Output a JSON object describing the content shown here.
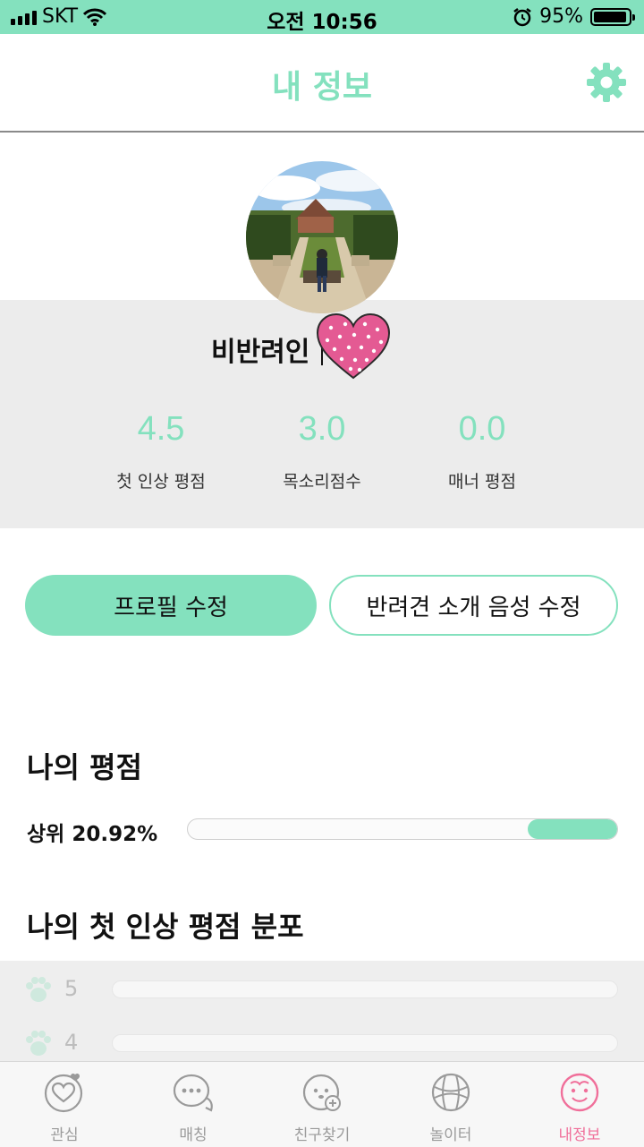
{
  "status_bar": {
    "carrier": "SKT",
    "time": "오전 10:56",
    "battery": "95%",
    "battery_level": 0.95
  },
  "header": {
    "title": "내 정보",
    "settings_icon": "gear-icon"
  },
  "profile": {
    "name": "비반려인"
  },
  "stats": [
    {
      "value": "4.5",
      "label": "첫 인상 평점"
    },
    {
      "value": "3.0",
      "label": "목소리점수"
    },
    {
      "value": "0.0",
      "label": "매너 평점"
    }
  ],
  "buttons": {
    "edit_profile": "프로필 수정",
    "edit_voice": "반려견 소개 음성 수정"
  },
  "rating": {
    "title": "나의 평점",
    "rank_label": "상위 20.92%",
    "rank_fill": 0.2092
  },
  "distribution": {
    "title": "나의 첫 인상 평점 분포",
    "rows": [
      {
        "score": "5"
      },
      {
        "score": "4"
      }
    ]
  },
  "tabs": [
    {
      "label": "관심",
      "icon": "heart-bubble-icon"
    },
    {
      "label": "매칭",
      "icon": "chat-bubbles-icon"
    },
    {
      "label": "친구찾기",
      "icon": "dog-plus-icon"
    },
    {
      "label": "놀이터",
      "icon": "ball-icon"
    },
    {
      "label": "내정보",
      "icon": "smiley-icon",
      "active": true
    }
  ],
  "colors": {
    "accent": "#84e1be",
    "active_tab": "#f06f9a",
    "panel": "#ececec"
  }
}
